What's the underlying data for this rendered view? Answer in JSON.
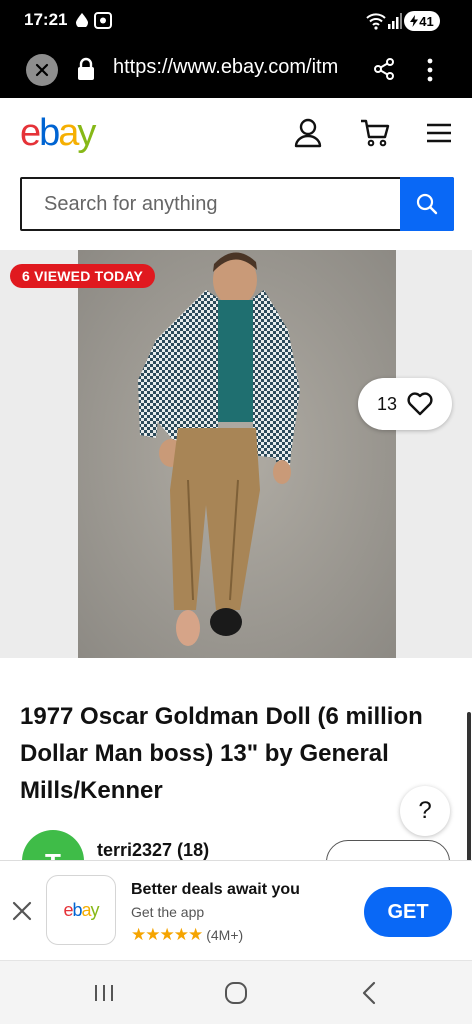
{
  "status_bar": {
    "time": "17:21",
    "battery": "41"
  },
  "browser": {
    "url": "https://www.ebay.com/itm",
    "icons": [
      "close-icon",
      "lock-icon",
      "share-icon",
      "more-vert-icon"
    ]
  },
  "header": {
    "logo": {
      "e": "e",
      "b": "b",
      "a": "a",
      "y": "y"
    },
    "icons": [
      "user-icon",
      "cart-icon",
      "menu-icon"
    ]
  },
  "search": {
    "placeholder": "Search for anything",
    "icon": "search-icon"
  },
  "listing": {
    "badge": "6 VIEWED TODAY",
    "watch_count": "13",
    "title": "1977 Oscar Goldman Doll (6 million Dollar Man boss) 13\" by General Mills/Kenner",
    "help": "?"
  },
  "seller": {
    "avatar_letter": "T",
    "name": "terri2327 (18)"
  },
  "app_banner": {
    "logo": {
      "e": "e",
      "b": "b",
      "a": "a",
      "y": "y"
    },
    "headline": "Better deals await you",
    "subtitle": "Get the app",
    "stars": "★★★★★",
    "rating_count": "(4M+)",
    "cta": "GET"
  },
  "colors": {
    "ebay_red": "#e53238",
    "ebay_blue": "#0064d2",
    "ebay_yellow": "#f5af02",
    "ebay_green": "#86b817",
    "action_blue": "#0968f6",
    "badge_red": "#e0191f"
  }
}
